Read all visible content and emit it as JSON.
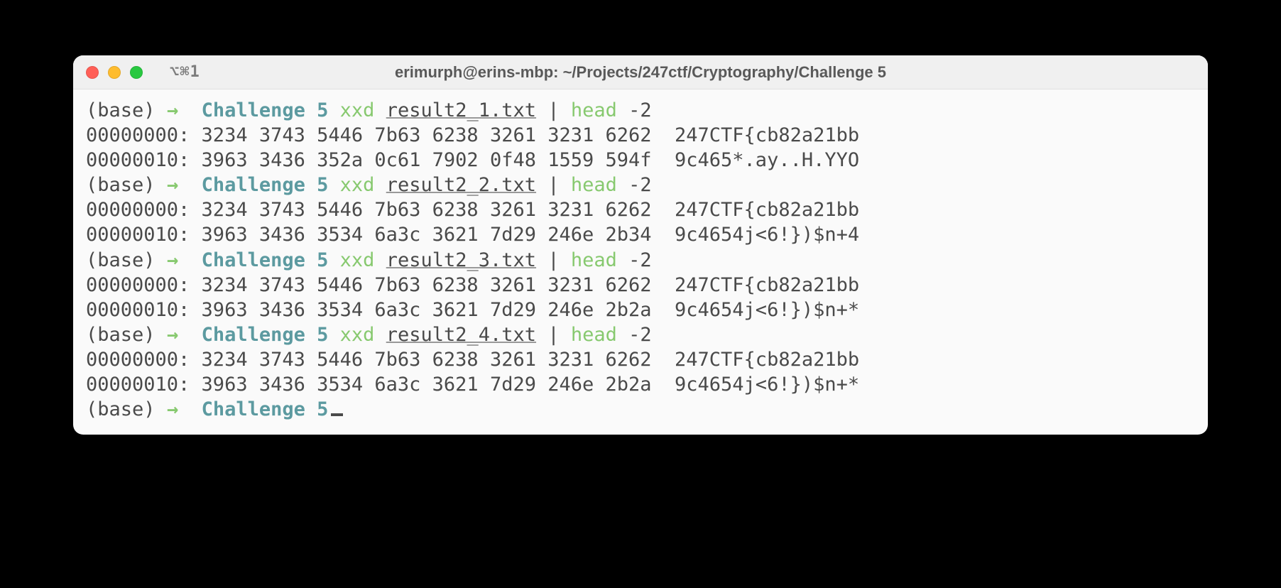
{
  "window": {
    "tab_indicator": "⌥⌘1",
    "title": "erimurph@erins-mbp: ~/Projects/247ctf/Cryptography/Challenge 5"
  },
  "prompt": {
    "base": "(base)",
    "arrow": "→",
    "cwd": "Challenge 5"
  },
  "commands": [
    {
      "cmd": "xxd",
      "file": "result2_1.txt",
      "pipe": "|",
      "cmd2": "head",
      "arg": "-2",
      "output": [
        "00000000: 3234 3743 5446 7b63 6238 3261 3231 6262  247CTF{cb82a21bb",
        "00000010: 3963 3436 352a 0c61 7902 0f48 1559 594f  9c465*.ay..H.YYO"
      ]
    },
    {
      "cmd": "xxd",
      "file": "result2_2.txt",
      "pipe": "|",
      "cmd2": "head",
      "arg": "-2",
      "output": [
        "00000000: 3234 3743 5446 7b63 6238 3261 3231 6262  247CTF{cb82a21bb",
        "00000010: 3963 3436 3534 6a3c 3621 7d29 246e 2b34  9c4654j<6!})$n+4"
      ]
    },
    {
      "cmd": "xxd",
      "file": "result2_3.txt",
      "pipe": "|",
      "cmd2": "head",
      "arg": "-2",
      "output": [
        "00000000: 3234 3743 5446 7b63 6238 3261 3231 6262  247CTF{cb82a21bb",
        "00000010: 3963 3436 3534 6a3c 3621 7d29 246e 2b2a  9c4654j<6!})$n+*"
      ]
    },
    {
      "cmd": "xxd",
      "file": "result2_4.txt",
      "pipe": "|",
      "cmd2": "head",
      "arg": "-2",
      "output": [
        "00000000: 3234 3743 5446 7b63 6238 3261 3231 6262  247CTF{cb82a21bb",
        "00000010: 3963 3436 3534 6a3c 3621 7d29 246e 2b2a  9c4654j<6!})$n+*"
      ]
    }
  ]
}
